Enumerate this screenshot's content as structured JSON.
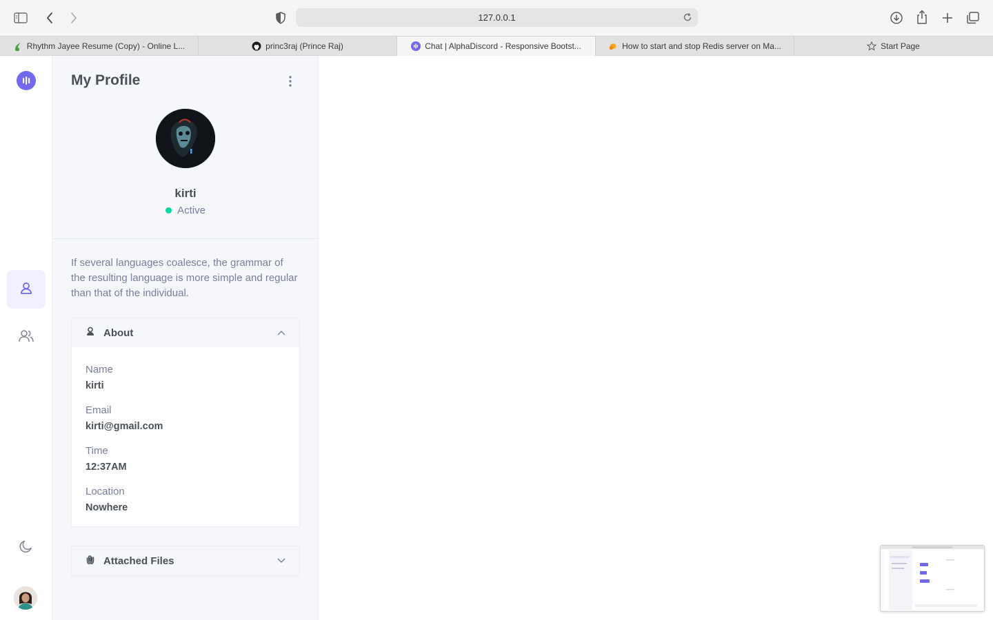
{
  "browser": {
    "url": "127.0.0.1",
    "tabs": [
      {
        "label": "Rhythm Jayee Resume (Copy) - Online L...",
        "icon": "overleaf-icon"
      },
      {
        "label": "princ3raj (Prince Raj)",
        "icon": "github-icon"
      },
      {
        "label": "Chat | AlphaDiscord - Responsive Bootst...",
        "icon": "app-logo-icon"
      },
      {
        "label": "How to start and stop Redis server on Ma...",
        "icon": "site-icon"
      },
      {
        "label": "Start Page",
        "icon": "star-icon"
      }
    ]
  },
  "sidebar": {
    "items": [
      {
        "name": "profile",
        "icon": "user-icon",
        "active": true
      },
      {
        "name": "contacts",
        "icon": "users-icon",
        "active": false
      },
      {
        "name": "theme",
        "icon": "moon-icon",
        "active": false
      }
    ]
  },
  "profile": {
    "title": "My Profile",
    "name": "kirti",
    "status": "Active",
    "bio": "If several languages coalesce, the grammar of the resulting language is more simple and regular than that of the individual."
  },
  "about": {
    "heading": "About",
    "fields": [
      {
        "label": "Name",
        "value": "kirti"
      },
      {
        "label": "Email",
        "value": "kirti@gmail.com"
      },
      {
        "label": "Time",
        "value": "12:37AM"
      },
      {
        "label": "Location",
        "value": "Nowhere"
      }
    ]
  },
  "attached_files": {
    "heading": "Attached Files"
  },
  "colors": {
    "accent": "#7269ef",
    "status_active": "#06d6a0",
    "panel_bg": "#f5f7fb"
  }
}
